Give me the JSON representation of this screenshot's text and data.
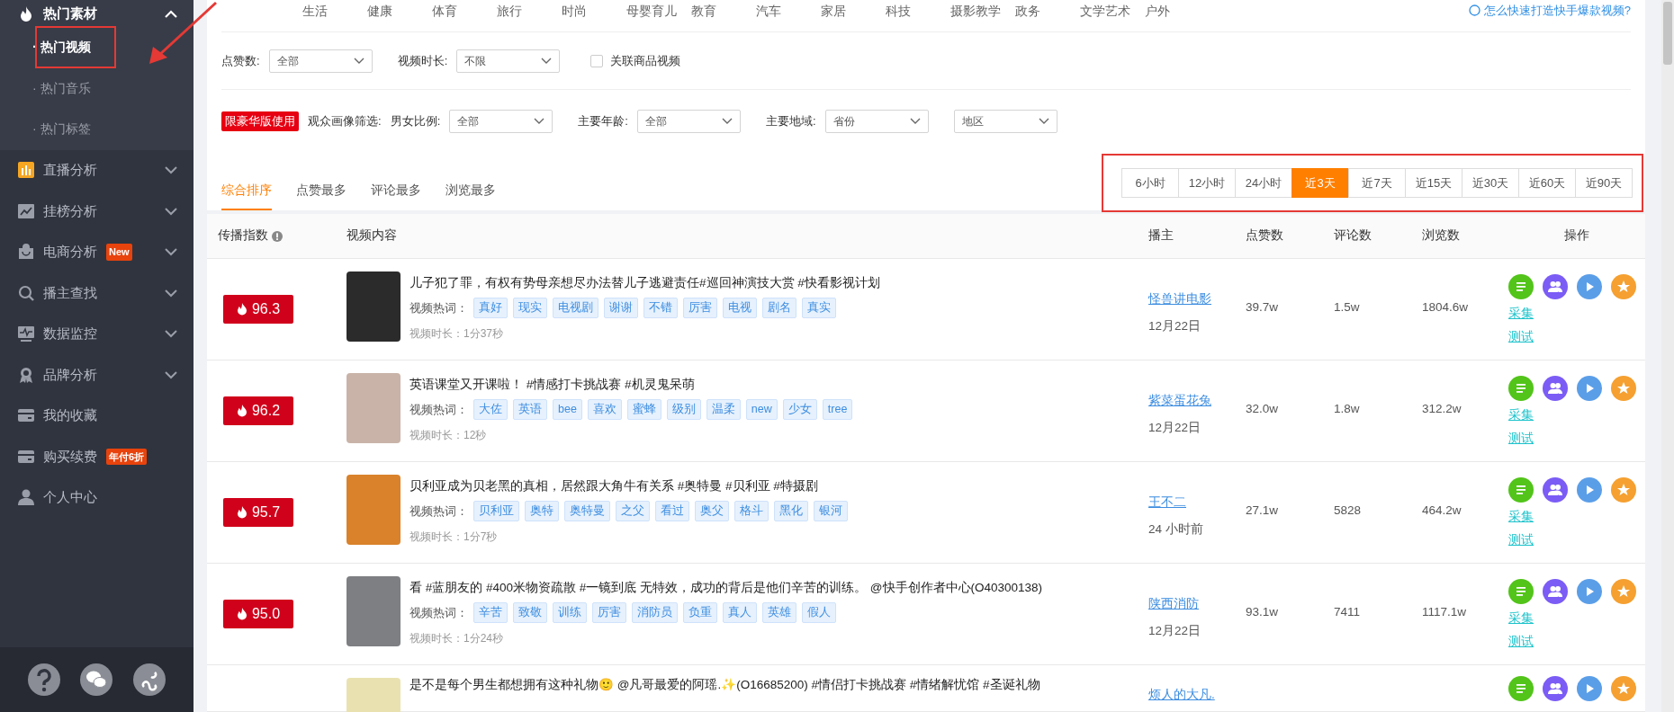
{
  "sidebar": {
    "items": [
      {
        "label": "热门素材",
        "kind": "group",
        "expanded": true,
        "children": [
          {
            "label": "· 热门视频",
            "selected": true
          },
          {
            "label": "· 热门音乐",
            "selected": false
          },
          {
            "label": "· 热门标签",
            "selected": false
          }
        ]
      },
      {
        "label": "直播分析",
        "kind": "group",
        "expanded": false
      },
      {
        "label": "挂榜分析",
        "kind": "group",
        "expanded": false
      },
      {
        "label": "电商分析",
        "kind": "group",
        "expanded": false,
        "badge": "New"
      },
      {
        "label": "播主查找",
        "kind": "group",
        "expanded": false
      },
      {
        "label": "数据监控",
        "kind": "group",
        "expanded": false
      },
      {
        "label": "品牌分析",
        "kind": "group",
        "expanded": false
      },
      {
        "label": "我的收藏",
        "kind": "link"
      },
      {
        "label": "购买续费",
        "kind": "link",
        "badge": "年付6折"
      },
      {
        "label": "个人中心",
        "kind": "link"
      }
    ]
  },
  "categories": [
    "生活",
    "健康",
    "体育",
    "旅行",
    "时尚",
    "母婴育儿",
    "教育",
    "汽车",
    "家居",
    "科技",
    "摄影教学",
    "政务",
    "文学艺术",
    "户外"
  ],
  "help_link": "怎么快速打造快手爆款视频?",
  "filters": {
    "selects": [
      {
        "label": "点赞数:",
        "value": "全部"
      },
      {
        "label": "视频时长:",
        "value": "不限"
      }
    ],
    "checkbox": {
      "label": "关联商品视频",
      "checked": false
    }
  },
  "audience_filters": {
    "badge": "限豪华版使用",
    "label": "观众画像筛选:",
    "selects": [
      {
        "label": "男女比例:",
        "value": "全部"
      },
      {
        "label": "主要年龄:",
        "value": "全部"
      },
      {
        "label": "主要地域:",
        "value": "省份"
      },
      {
        "value": "地区"
      }
    ]
  },
  "sort_tabs": [
    {
      "label": "综合排序",
      "selected": true
    },
    {
      "label": "点赞最多",
      "selected": false
    },
    {
      "label": "评论最多",
      "selected": false
    },
    {
      "label": "浏览最多",
      "selected": false
    }
  ],
  "time_ranges": [
    {
      "label": "6小时",
      "selected": false
    },
    {
      "label": "12小时",
      "selected": false
    },
    {
      "label": "24小时",
      "selected": false
    },
    {
      "label": "近3天",
      "selected": true
    },
    {
      "label": "近7天",
      "selected": false
    },
    {
      "label": "近15天",
      "selected": false
    },
    {
      "label": "近30天",
      "selected": false
    },
    {
      "label": "近60天",
      "selected": false
    },
    {
      "label": "近90天",
      "selected": false
    }
  ],
  "table": {
    "columns": [
      "传播指数",
      "视频内容",
      "播主",
      "点赞数",
      "评论数",
      "浏览数",
      "操作"
    ],
    "rows": [
      {
        "score": "96.3",
        "title": "儿子犯了罪，有权有势母亲想尽办法替儿子逃避责任#巡回神演技大赏  #快看影视计划",
        "hotwords_label": "视频热词：",
        "tags": [
          "真好",
          "现实",
          "电视剧",
          "谢谢",
          "不错",
          "厉害",
          "电视",
          "剧名",
          "真实"
        ],
        "duration": "视频时长：1分37秒",
        "author": "怪兽讲电影",
        "date": "12月22日",
        "likes": "39.7w",
        "comments": "1.5w",
        "views": "1804.6w",
        "actions": [
          "采集",
          "测试"
        ]
      },
      {
        "score": "96.2",
        "title": "英语课堂又开课啦！ #情感打卡挑战赛 #机灵鬼呆萌",
        "hotwords_label": "视频热词：",
        "tags": [
          "大佐",
          "英语",
          "bee",
          "喜欢",
          "蜜蜂",
          "级别",
          "温柔",
          "new",
          "少女",
          "tree"
        ],
        "duration": "视频时长：12秒",
        "author": "紫菜蛋花兔",
        "date": "12月22日",
        "likes": "32.0w",
        "comments": "1.8w",
        "views": "312.2w",
        "actions": [
          "采集",
          "测试"
        ]
      },
      {
        "score": "95.7",
        "title": "贝利亚成为贝老黑的真相，居然跟大角牛有关系 #奥特曼 #贝利亚 #特摄剧",
        "hotwords_label": "视频热词：",
        "tags": [
          "贝利亚",
          "奥特",
          "奥特曼",
          "之父",
          "看过",
          "奥父",
          "格斗",
          "黑化",
          "银河"
        ],
        "duration": "视频时长：1分7秒",
        "author": "王不二",
        "date": "24 小时前",
        "likes": "27.1w",
        "comments": "5828",
        "views": "464.2w",
        "actions": [
          "采集",
          "测试"
        ]
      },
      {
        "score": "95.0",
        "title": "看 #蓝朋友的 #400米物资疏散 #一镜到底 无特效，成功的背后是他们辛苦的训练。 @快手创作者中心(O40300138)",
        "hotwords_label": "视频热词：",
        "tags": [
          "辛苦",
          "致敬",
          "训练",
          "厉害",
          "消防员",
          "负重",
          "真人",
          "英雄",
          "假人"
        ],
        "duration": "视频时长：1分24秒",
        "author": "陕西消防",
        "date": "12月22日",
        "likes": "93.1w",
        "comments": "7411",
        "views": "1117.1w",
        "actions": [
          "采集",
          "测试"
        ]
      },
      {
        "title": "是不是每个男生都想拥有这种礼物🙂 @凡哥最爱的阿瑶.✨(O16685200) #情侣打卡挑战赛 #情绪解忧馆 #圣诞礼物",
        "author": "烦人的大凡."
      }
    ]
  }
}
